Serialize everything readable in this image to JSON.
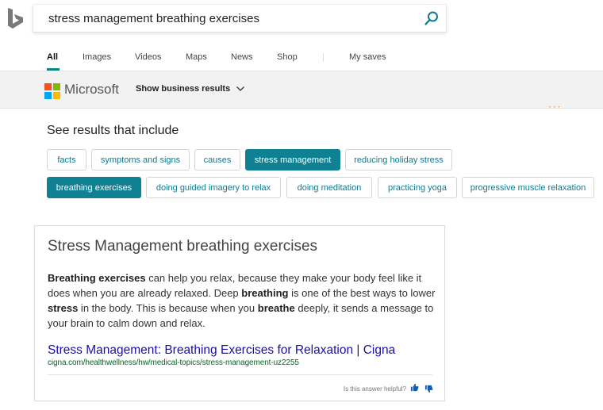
{
  "search": {
    "query": "stress management breathing exercises"
  },
  "nav": {
    "tabs": [
      "All",
      "Images",
      "Videos",
      "Maps",
      "News",
      "Shop"
    ],
    "my_saves": "My saves"
  },
  "business": {
    "brand": "Microsoft",
    "show_label": "Show business results"
  },
  "refinements": {
    "title": "See results that include",
    "chips": [
      "facts",
      "symptoms and signs",
      "causes",
      "stress management",
      "reducing holiday stress",
      "breathing exercises",
      "doing guided imagery to relax",
      "doing meditation",
      "practicing yoga",
      "progressive muscle relaxation"
    ],
    "selected": [
      "stress management",
      "breathing exercises"
    ]
  },
  "answer": {
    "title": "Stress Management breathing exercises",
    "body_parts": [
      {
        "t": "Breathing exercises",
        "b": true
      },
      {
        "t": " can help you relax, because they make your body feel like it does when you are already relaxed. Deep ",
        "b": false
      },
      {
        "t": "breathing",
        "b": true
      },
      {
        "t": " is one of the best ways to lower ",
        "b": false
      },
      {
        "t": "stress",
        "b": true
      },
      {
        "t": " in the body. This is because when you ",
        "b": false
      },
      {
        "t": "breathe",
        "b": true
      },
      {
        "t": " deeply, it sends a message to your brain to calm down and relax.",
        "b": false
      }
    ],
    "link_text": "Stress Management: Breathing Exercises for Relaxation | Cigna",
    "cite": "cigna.com/healthwellness/hw/medical-topics/stress-management-uz2255",
    "helpful_prompt": "Is this answer helpful?"
  },
  "colors": {
    "accent": "#0f8193",
    "link": "#1a0dab",
    "cite": "#006621",
    "band": "#f2f2f2"
  }
}
